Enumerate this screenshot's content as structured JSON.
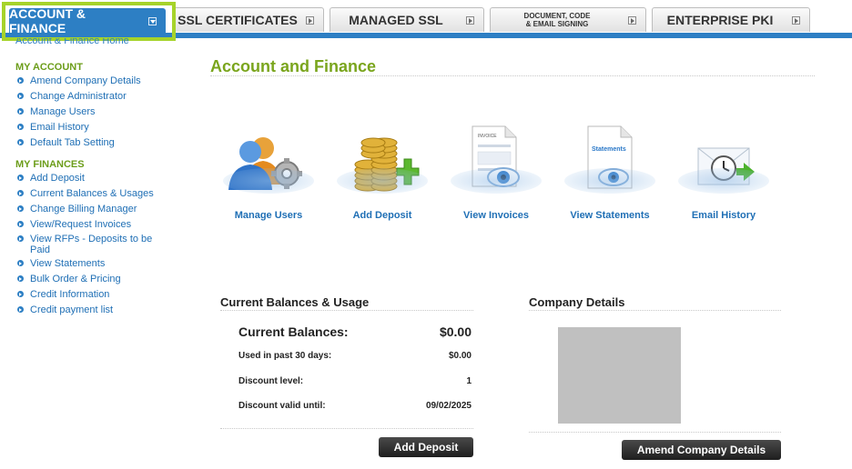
{
  "tabs": [
    {
      "label": "ACCOUNT & FINANCE",
      "active": true
    },
    {
      "label": "SSL CERTIFICATES"
    },
    {
      "label": "MANAGED SSL"
    },
    {
      "label_line1": "DOCUMENT, CODE",
      "label_line2": "& EMAIL SIGNING"
    },
    {
      "label": "ENTERPRISE PKI"
    }
  ],
  "sidebar": {
    "breadcrumb": "Account & Finance Home",
    "my_account_title": "MY ACCOUNT",
    "my_account": [
      "Amend Company Details",
      "Change Administrator",
      "Manage Users",
      "Email History",
      "Default Tab Setting"
    ],
    "my_finances_title": "MY FINANCES",
    "my_finances": [
      "Add Deposit",
      "Current Balances & Usages",
      "Change Billing Manager",
      "View/Request Invoices",
      "View RFPs - Deposits to be Paid",
      "View Statements",
      "Bulk Order & Pricing",
      "Credit Information",
      "Credit payment list"
    ]
  },
  "main": {
    "title": "Account and Finance",
    "icons": [
      {
        "label": "Manage Users",
        "icon": "users-gear-icon"
      },
      {
        "label": "Add Deposit",
        "icon": "coins-plus-icon"
      },
      {
        "label": "View Invoices",
        "icon": "invoice-eye-icon",
        "doc_text": "INVOICE"
      },
      {
        "label": "View Statements",
        "icon": "statement-eye-icon",
        "doc_text": "Statements"
      },
      {
        "label": "Email History",
        "icon": "envelope-clock-icon"
      }
    ]
  },
  "balances": {
    "title": "Current Balances & Usage",
    "current_label": "Current Balances:",
    "current_value": "$0.00",
    "used_label": "Used in past 30 days:",
    "used_value": "$0.00",
    "discount_label": "Discount level:",
    "discount_value": "1",
    "valid_label": "Discount valid until:",
    "valid_value": "09/02/2025",
    "button": "Add Deposit"
  },
  "company": {
    "title": "Company Details",
    "button": "Amend Company Details"
  },
  "colors": {
    "accent_blue": "#2d7fc4",
    "title_green": "#7aa51d",
    "highlight": "#a6d32a"
  }
}
